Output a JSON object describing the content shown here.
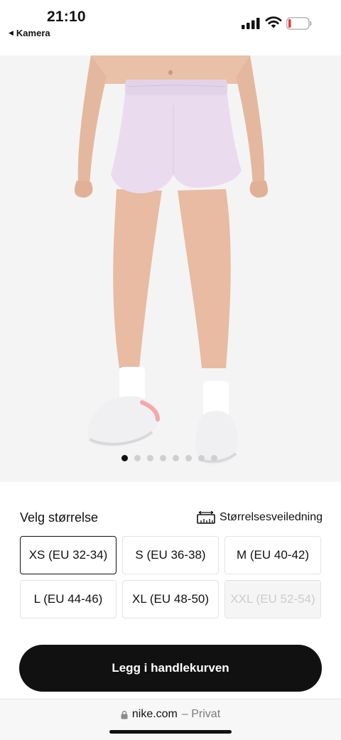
{
  "status_bar": {
    "time": "21:10",
    "back_app": "Kamera",
    "icons": [
      "signal-icon",
      "wifi-icon",
      "battery-icon"
    ],
    "battery_color": "#e53935"
  },
  "product_image": {
    "slides_total": 8,
    "active_slide": 1
  },
  "size_section": {
    "title": "Velg størrelse",
    "guide_label": "Størrelsesveiledning",
    "guide_icon": "ruler-icon",
    "sizes": [
      {
        "label": "XS (EU 32-34)",
        "state": "selected"
      },
      {
        "label": "S (EU 36-38)",
        "state": "available"
      },
      {
        "label": "M (EU 40-42)",
        "state": "available"
      },
      {
        "label": "L (EU 44-46)",
        "state": "available"
      },
      {
        "label": "XL (EU 48-50)",
        "state": "available"
      },
      {
        "label": "XXL (EU 52-54)",
        "state": "unavailable"
      }
    ]
  },
  "cart": {
    "label": "Legg i handlekurven"
  },
  "browser": {
    "domain": "nike.com",
    "privacy": "– Privat"
  },
  "colors": {
    "accent": "#111111",
    "image_bg": "#f4f4f4",
    "disabled_text": "#cccccc"
  }
}
